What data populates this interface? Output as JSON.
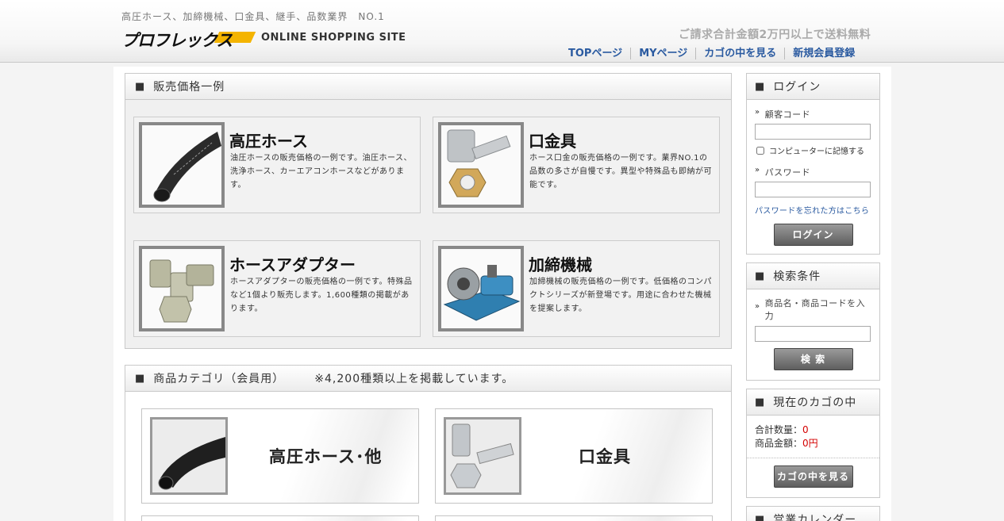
{
  "header": {
    "tagline": "高圧ホース、加締機械、口金具、継手、品数業界　NO.1",
    "logo_text": "プロフレックス",
    "site_sub": "ONLINE SHOPPING SITE",
    "shipping_note": "ご請求合計金額2万円以上で送料無料",
    "nav": [
      "TOPページ",
      "MYページ",
      "カゴの中を見る",
      "新規会員登録"
    ]
  },
  "price_section": {
    "title": "販売価格一例",
    "cards": [
      {
        "title": "高圧ホース",
        "desc": "油圧ホースの販売価格の一例です。油圧ホース、洗浄ホース、カーエアコンホースなどがあります。"
      },
      {
        "title": "口金具",
        "desc": "ホース口金の販売価格の一例です。業界NO.1の品数の多さが自慢です。異型や特殊品も即納が可能です。"
      },
      {
        "title": "ホースアダプター",
        "desc": "ホースアダプターの販売価格の一例です。特殊品など1個より販売します。1,600種類の掲載があります。"
      },
      {
        "title": "加締機械",
        "desc": "加締機械の販売価格の一例です。低価格のコンパクトシリーズが新登場です。用途に合わせた機械を提案します。"
      }
    ]
  },
  "category_section": {
    "title": "商品カテゴリ（会員用）",
    "note": "※4,200種類以上を掲載しています。",
    "cards": [
      {
        "label": "高圧ホース･他"
      },
      {
        "label": "口金具"
      }
    ]
  },
  "login": {
    "title": "ログイン",
    "customer_code_label": "顧客コード",
    "customer_code_value": "",
    "remember_label": "コンピューターに記憶する",
    "password_label": "パスワード",
    "password_value": "",
    "forgot_link": "パスワードを忘れた方はこちら",
    "button": "ログイン"
  },
  "search": {
    "title": "検索条件",
    "label": "商品名・商品コードを入力",
    "value": "",
    "button": "検 索"
  },
  "cart": {
    "title": "現在のカゴの中",
    "qty_label": "合計数量：",
    "qty_value": "0",
    "amount_label": "商品金額：",
    "amount_value": "0円",
    "button": "カゴの中を見る"
  },
  "calendar": {
    "title": "営業カレンダー"
  },
  "colors": {
    "nav_link": "#2a5aa0",
    "cart_value": "#d40000",
    "logo_accent": "#f4b400"
  }
}
